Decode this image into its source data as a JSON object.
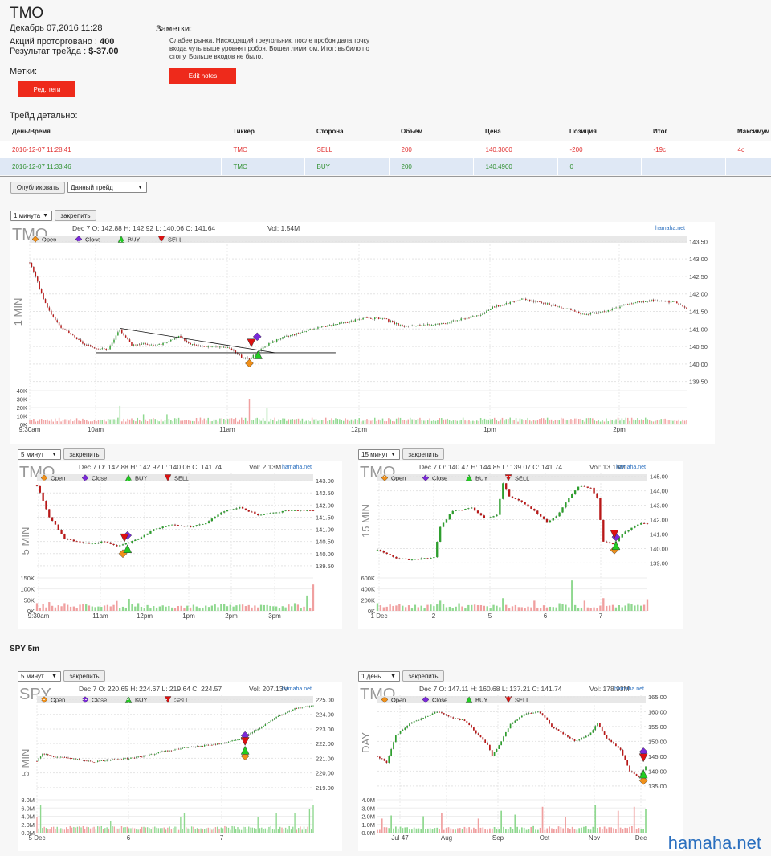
{
  "header": {
    "ticker": "TMO",
    "datetime": "Декабрь 07,2016 11:28",
    "shares_label": "Акций проторговано :",
    "shares_value": "400",
    "result_label": "Результат трейда :",
    "result_value": "$-37.00",
    "tags_label": "Метки:",
    "tags_button": "Ред. теги",
    "notes_title": "Заметки:",
    "notes_text": "Слабее рынка. Нисходящий треугольник. после пробоя дала точку входа чуть выше уровня пробоя. Вошел лимитом. Итог: выбило по стопу. Больше входов не было.",
    "notes_button": "Edit notes"
  },
  "trade_detail": {
    "title": "Трейд детально:",
    "columns": [
      "День/Время",
      "Тиккер",
      "Сторона",
      "Объём",
      "Цена",
      "Позиция",
      "Итог",
      "Максимум"
    ],
    "rows": [
      {
        "side": "sell",
        "cells": [
          "2016-12-07 11:28:41",
          "TMO",
          "SELL",
          "200",
          "140.3000",
          "-200",
          "-19c",
          "4c"
        ]
      },
      {
        "side": "buy",
        "cells": [
          "2016-12-07 11:33:46",
          "TMO",
          "BUY",
          "200",
          "140.4900",
          "0",
          "",
          ""
        ]
      }
    ]
  },
  "controls": {
    "publish_button": "Опубликовать",
    "trade_select": "Данный трейд",
    "pin_button": "закрепить"
  },
  "section_spy": "SPY 5m",
  "watermark": "hamaha.net",
  "colors": {
    "up": "#2e9e2e",
    "down": "#b81818",
    "vol_up": "#8fd88f",
    "vol_down": "#f0a0a0",
    "open_marker": "#f0901a",
    "close_marker": "#7a2ad8",
    "buy_marker": "#22cc22",
    "sell_marker": "#dd1111",
    "brand": "#2a6fbf",
    "red_button": "#ee2a1b"
  },
  "chart_data": [
    {
      "id": "c1",
      "type": "candlestick",
      "symbol": "TMO",
      "interval": "1 минута",
      "side_label": "1 MIN",
      "info": "Dec 7 O: 142.88 H: 142.92 L: 140.06 C: 141.64",
      "vol": "Vol: 1.54M",
      "brand": "hamaha.net",
      "legend": [
        "Open",
        "Close",
        "BUY",
        "SELL"
      ],
      "ylim": [
        139.4,
        143.6
      ],
      "yticks": [
        "143.50",
        "143.00",
        "142.50",
        "142.00",
        "141.50",
        "141.00",
        "140.50",
        "140.00",
        "139.50"
      ],
      "vticks": [
        "40K",
        "30K",
        "20K",
        "10K",
        "0K"
      ],
      "vmax": 40,
      "xticks": [
        "9:30am",
        "10am",
        "11am",
        "12pm",
        "1pm",
        "2pm"
      ],
      "anchors": [
        [
          0,
          142.9
        ],
        [
          3,
          142.5
        ],
        [
          6,
          142.0
        ],
        [
          10,
          141.5
        ],
        [
          16,
          141.05
        ],
        [
          22,
          140.8
        ],
        [
          28,
          140.55
        ],
        [
          34,
          140.45
        ],
        [
          40,
          140.42
        ],
        [
          46,
          140.98
        ],
        [
          52,
          140.55
        ],
        [
          58,
          140.58
        ],
        [
          64,
          140.52
        ],
        [
          70,
          140.62
        ],
        [
          76,
          140.78
        ],
        [
          82,
          140.58
        ],
        [
          88,
          140.5
        ],
        [
          95,
          140.5
        ],
        [
          102,
          140.45
        ],
        [
          108,
          140.2
        ],
        [
          112,
          140.12
        ],
        [
          117,
          140.4
        ],
        [
          121,
          140.55
        ],
        [
          127,
          140.72
        ],
        [
          135,
          140.85
        ],
        [
          145,
          141.02
        ],
        [
          160,
          141.18
        ],
        [
          170,
          141.3
        ],
        [
          180,
          141.3
        ],
        [
          190,
          141.08
        ],
        [
          200,
          141.1
        ],
        [
          210,
          141.15
        ],
        [
          222,
          141.3
        ],
        [
          232,
          141.45
        ],
        [
          236,
          141.62
        ],
        [
          245,
          141.75
        ],
        [
          251,
          141.85
        ],
        [
          255,
          141.82
        ],
        [
          265,
          141.7
        ],
        [
          275,
          141.55
        ],
        [
          282,
          141.42
        ],
        [
          292,
          141.48
        ],
        [
          300,
          141.62
        ],
        [
          310,
          141.78
        ],
        [
          318,
          141.82
        ],
        [
          325,
          141.78
        ],
        [
          330,
          141.75
        ],
        [
          335,
          141.55
        ]
      ],
      "vol_spikes": [
        [
          0,
          5
        ],
        [
          9,
          6
        ],
        [
          28,
          5
        ],
        [
          38,
          6
        ],
        [
          46,
          22
        ],
        [
          58,
          12
        ],
        [
          70,
          12
        ],
        [
          87,
          8
        ],
        [
          102,
          7
        ],
        [
          108,
          8
        ],
        [
          112,
          30
        ],
        [
          121,
          20
        ],
        [
          135,
          6
        ],
        [
          145,
          6
        ],
        [
          163,
          4
        ],
        [
          190,
          5
        ],
        [
          221,
          8
        ],
        [
          240,
          6
        ],
        [
          270,
          5
        ],
        [
          300,
          8
        ],
        [
          330,
          4
        ]
      ],
      "markers": {
        "sell": [
          113,
          140.6
        ],
        "close": [
          116,
          140.78
        ],
        "open": [
          112,
          140.02
        ],
        "buy": [
          116.5,
          140.26
        ]
      }
    },
    {
      "id": "c2",
      "type": "candlestick",
      "symbol": "TMO",
      "interval": "5 минут",
      "side_label": "5 MIN",
      "info": "Dec 7 O: 142.88 H: 142.92 L: 140.06 C: 141.74",
      "vol": "Vol: 2.13M",
      "brand": "hamaha.net",
      "legend": [
        "Open",
        "Close",
        "BUY",
        "SELL"
      ],
      "ylim": [
        139.2,
        143.3
      ],
      "yticks": [
        "143.00",
        "142.50",
        "142.00",
        "141.50",
        "141.00",
        "140.50",
        "140.00",
        "139.50"
      ],
      "vticks": [
        "150K",
        "100K",
        "50K",
        "0K"
      ],
      "vmax": 150,
      "xticks": [
        "9:30am",
        "11am",
        "12pm",
        "1pm",
        "2pm",
        "3pm"
      ],
      "anchors": [
        [
          0,
          142.8
        ],
        [
          2,
          142.2
        ],
        [
          4,
          141.5
        ],
        [
          6,
          141.2
        ],
        [
          9,
          140.6
        ],
        [
          13,
          140.5
        ],
        [
          18,
          140.4
        ],
        [
          22,
          140.5
        ],
        [
          26,
          140.3
        ],
        [
          30,
          140.45
        ],
        [
          33,
          140.6
        ],
        [
          38,
          141.0
        ],
        [
          44,
          141.2
        ],
        [
          50,
          141.1
        ],
        [
          55,
          141.25
        ],
        [
          60,
          141.7
        ],
        [
          66,
          141.9
        ],
        [
          72,
          141.6
        ],
        [
          78,
          141.7
        ],
        [
          84,
          141.8
        ],
        [
          90,
          141.75
        ]
      ],
      "vol_spikes": [
        [
          0,
          35
        ],
        [
          4,
          40
        ],
        [
          9,
          35
        ],
        [
          18,
          20
        ],
        [
          26,
          45
        ],
        [
          30,
          55
        ],
        [
          33,
          35
        ],
        [
          40,
          20
        ],
        [
          50,
          15
        ],
        [
          65,
          25
        ],
        [
          78,
          20
        ],
        [
          84,
          35
        ],
        [
          88,
          70
        ],
        [
          90,
          120
        ]
      ],
      "markers": {
        "sell": [
          28.5,
          140.65
        ],
        "close": [
          29.5,
          140.75
        ],
        "open": [
          28,
          140.0
        ],
        "buy": [
          29.5,
          140.2
        ]
      }
    },
    {
      "id": "c3",
      "type": "candlestick",
      "symbol": "TMO",
      "interval": "15 минут",
      "side_label": "15 MIN",
      "info": "Dec 7 O: 140.47 H: 144.85 L: 139.07 C: 141.74",
      "vol": "Vol: 13.18M",
      "brand": "hamaha.net",
      "legend": [
        "Open",
        "Close",
        "BUY",
        "SELL"
      ],
      "ylim": [
        138.3,
        145.2
      ],
      "yticks": [
        "145.00",
        "144.00",
        "143.00",
        "142.00",
        "141.00",
        "140.00",
        "139.00"
      ],
      "vticks": [
        "600K",
        "400K",
        "200K",
        "0K"
      ],
      "vmax": 650,
      "xticks": [
        "1 Dec",
        "2",
        "5",
        "6",
        "7"
      ],
      "anchors": [
        [
          0,
          139.9
        ],
        [
          5,
          139.4
        ],
        [
          10,
          139.2
        ],
        [
          15,
          139.3
        ],
        [
          18,
          139.4
        ],
        [
          20,
          141.5
        ],
        [
          24,
          142.6
        ],
        [
          30,
          142.8
        ],
        [
          34,
          142.1
        ],
        [
          38,
          142.3
        ],
        [
          40,
          144.5
        ],
        [
          42,
          143.6
        ],
        [
          46,
          143.2
        ],
        [
          50,
          142.6
        ],
        [
          54,
          141.8
        ],
        [
          57,
          142.2
        ],
        [
          60,
          143.2
        ],
        [
          64,
          144.3
        ],
        [
          68,
          144.2
        ],
        [
          70,
          143.5
        ],
        [
          72,
          140.5
        ],
        [
          75,
          140.3
        ],
        [
          78,
          141.0
        ],
        [
          83,
          141.7
        ],
        [
          86,
          141.74
        ]
      ],
      "vol_spikes": [
        [
          0,
          150
        ],
        [
          10,
          110
        ],
        [
          20,
          200
        ],
        [
          26,
          150
        ],
        [
          40,
          250
        ],
        [
          50,
          200
        ],
        [
          58,
          150
        ],
        [
          62,
          600
        ],
        [
          66,
          200
        ],
        [
          72,
          250
        ],
        [
          80,
          150
        ],
        [
          86,
          230
        ]
      ],
      "markers": {
        "sell": [
          75.5,
          141.0
        ],
        "close": [
          76,
          140.8
        ],
        "open": [
          75.5,
          139.9
        ],
        "buy": [
          76,
          140.2
        ]
      }
    },
    {
      "id": "c4",
      "type": "candlestick",
      "symbol": "SPY",
      "interval": "5 минут",
      "side_label": "5 MIN",
      "info": "Dec 7 O: 220.65 H: 224.67 L: 219.64 C: 224.57",
      "vol": "Vol: 207.13M",
      "brand": "hamaha.net",
      "legend": [
        "Open",
        "Close",
        "BUY",
        "SELL"
      ],
      "ylim": [
        218.5,
        225.3
      ],
      "yticks": [
        "225.00",
        "224.00",
        "223.00",
        "222.00",
        "221.00",
        "220.00",
        "219.00"
      ],
      "vticks": [
        "8.0M",
        "6.0M",
        "4.0M",
        "2.0M",
        "0.0M"
      ],
      "vmax": 8.4,
      "xticks": [
        "5 Dec",
        "6",
        "7"
      ],
      "anchors": [
        [
          0,
          220.8
        ],
        [
          3,
          221.3
        ],
        [
          10,
          221.1
        ],
        [
          20,
          221.0
        ],
        [
          30,
          220.75
        ],
        [
          40,
          220.9
        ],
        [
          50,
          221.0
        ],
        [
          60,
          221.2
        ],
        [
          70,
          221.5
        ],
        [
          80,
          221.7
        ],
        [
          90,
          221.85
        ],
        [
          100,
          222.0
        ],
        [
          110,
          222.3
        ],
        [
          120,
          223.0
        ],
        [
          130,
          223.8
        ],
        [
          140,
          224.4
        ],
        [
          150,
          224.6
        ]
      ],
      "vol_spikes": [
        [
          0,
          4
        ],
        [
          2,
          7
        ],
        [
          40,
          3
        ],
        [
          78,
          4
        ],
        [
          80,
          5
        ],
        [
          120,
          4
        ],
        [
          130,
          5
        ],
        [
          140,
          5
        ],
        [
          148,
          6
        ],
        [
          150,
          7
        ]
      ],
      "markers": {
        "sell": [
          113,
          222.15
        ],
        "close": [
          113,
          222.55
        ],
        "open": [
          113,
          221.15
        ],
        "buy": [
          113,
          221.55
        ]
      }
    },
    {
      "id": "c5",
      "type": "candlestick",
      "symbol": "TMO",
      "interval": "1 день",
      "side_label": "DAY",
      "info": "Dec 7 O: 147.11 H: 160.68 L: 137.21 C: 141.74",
      "vol": "Vol: 178.93M",
      "brand": "hamaha.net",
      "legend": [
        "Open",
        "Close",
        "BUY",
        "SELL"
      ],
      "ylim": [
        132,
        165.5
      ],
      "yticks": [
        "165.00",
        "160.00",
        "155.00",
        "150.00",
        "145.00",
        "140.00",
        "135.00"
      ],
      "vticks": [
        "4.0M",
        "3.0M",
        "2.0M",
        "1.0M",
        "0.0M"
      ],
      "vmax": 4.2,
      "xticks": [
        "Jul 47",
        "Aug",
        "Sep",
        "Oct",
        "Nov",
        "Dec"
      ],
      "anchors": [
        [
          0,
          145
        ],
        [
          4,
          143
        ],
        [
          8,
          152
        ],
        [
          14,
          156
        ],
        [
          20,
          158
        ],
        [
          26,
          160
        ],
        [
          32,
          158
        ],
        [
          38,
          157
        ],
        [
          44,
          152
        ],
        [
          48,
          149
        ],
        [
          50,
          145
        ],
        [
          54,
          150
        ],
        [
          58,
          156
        ],
        [
          64,
          159
        ],
        [
          70,
          160
        ],
        [
          73,
          158
        ],
        [
          76,
          155
        ],
        [
          80,
          153
        ],
        [
          86,
          150
        ],
        [
          92,
          152
        ],
        [
          96,
          156
        ],
        [
          100,
          151
        ],
        [
          106,
          147
        ],
        [
          110,
          140
        ],
        [
          114,
          138
        ],
        [
          117,
          141.7
        ]
      ],
      "vol_spikes": [
        [
          2,
          1.8
        ],
        [
          6,
          2.2
        ],
        [
          20,
          2.1
        ],
        [
          28,
          2.5
        ],
        [
          44,
          1.8
        ],
        [
          54,
          2.8
        ],
        [
          60,
          2.3
        ],
        [
          72,
          3.3
        ],
        [
          82,
          2.0
        ],
        [
          95,
          3.5
        ],
        [
          105,
          2.8
        ],
        [
          112,
          3.3
        ],
        [
          117,
          3.0
        ]
      ],
      "markers": {
        "sell": [
          116,
          144.5
        ],
        "close": [
          116,
          146.5
        ],
        "open": [
          116,
          136.8
        ],
        "buy": [
          116,
          139
        ]
      }
    }
  ]
}
